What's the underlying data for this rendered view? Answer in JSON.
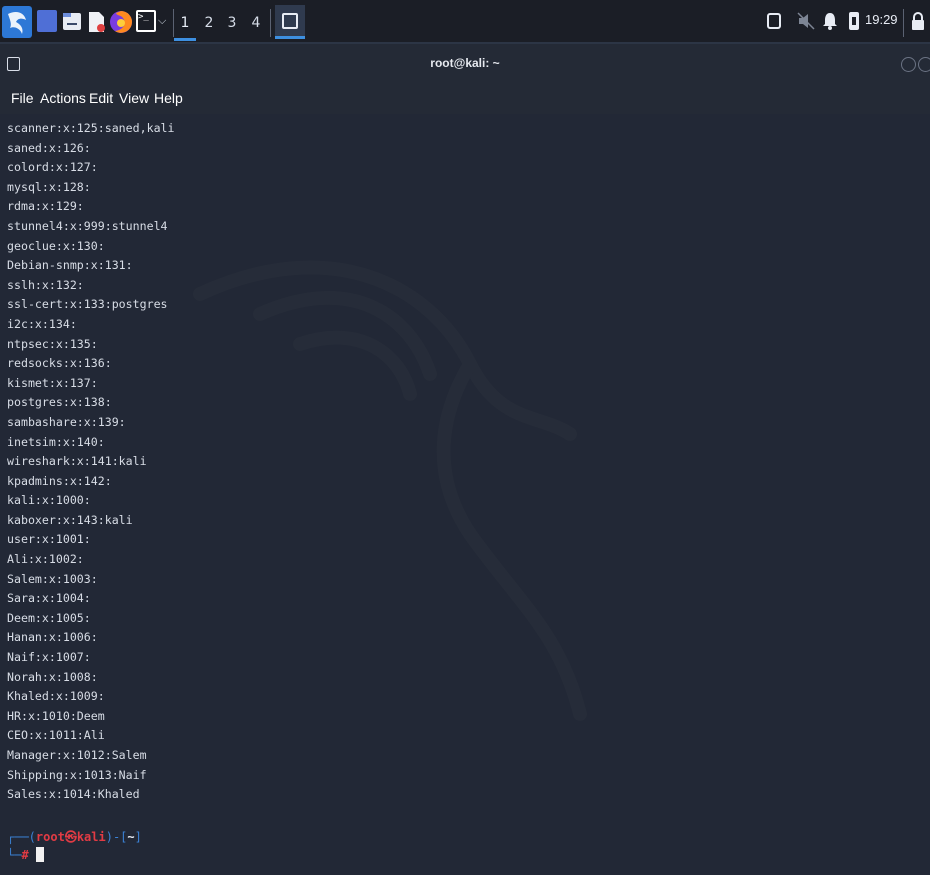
{
  "panel": {
    "workspaces": [
      "1",
      "2",
      "3",
      "4"
    ],
    "clock": "19:29"
  },
  "window": {
    "title": "root@kali: ~"
  },
  "menubar": {
    "items": [
      "File",
      "Actions",
      "Edit",
      "View",
      "Help"
    ]
  },
  "terminal": {
    "lines": [
      "scanner:x:125:saned,kali",
      "saned:x:126:",
      "colord:x:127:",
      "mysql:x:128:",
      "rdma:x:129:",
      "stunnel4:x:999:stunnel4",
      "geoclue:x:130:",
      "Debian-snmp:x:131:",
      "sslh:x:132:",
      "ssl-cert:x:133:postgres",
      "i2c:x:134:",
      "ntpsec:x:135:",
      "redsocks:x:136:",
      "kismet:x:137:",
      "postgres:x:138:",
      "sambashare:x:139:",
      "inetsim:x:140:",
      "wireshark:x:141:kali",
      "kpadmins:x:142:",
      "kali:x:1000:",
      "kaboxer:x:143:kali",
      "user:x:1001:",
      "Ali:x:1002:",
      "Salem:x:1003:",
      "Sara:x:1004:",
      "Deem:x:1005:",
      "Hanan:x:1006:",
      "Naif:x:1007:",
      "Norah:x:1008:",
      "Khaled:x:1009:",
      "HR:x:1010:Deem",
      "CEO:x:1011:Ali",
      "Manager:x:1012:Salem",
      "Shipping:x:1013:Naif",
      "Sales:x:1014:Khaled"
    ],
    "prompt": {
      "user": "root",
      "at": "㉿",
      "host": "kali",
      "dir": "~",
      "symbol": "#"
    }
  }
}
